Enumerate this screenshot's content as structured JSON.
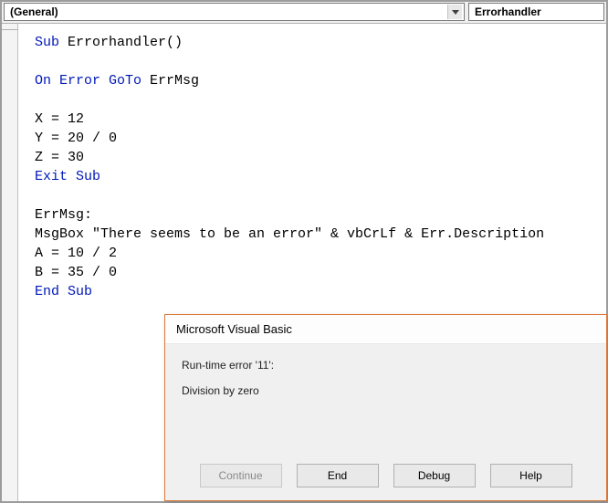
{
  "toolbar": {
    "object_combo": "(General)",
    "procedure_combo": "Errorhandler"
  },
  "code": {
    "sub_decl": {
      "kw1": "Sub",
      "name": " Errorhandler()"
    },
    "on_error": {
      "kw": "On Error GoTo",
      "label": " ErrMsg"
    },
    "l1": "X = 12",
    "l2": "Y = 20 / 0",
    "l3": "Z = 30",
    "exit_sub": "Exit Sub",
    "errmsg_label": "ErrMsg:",
    "msgbox": "MsgBox \"There seems to be an error\" & vbCrLf & Err.Description",
    "l4": "A = 10 / 2",
    "l5": "B = 35 / 0",
    "end_sub": "End Sub"
  },
  "dialog": {
    "title": "Microsoft Visual Basic",
    "error_header": "Run-time error '11':",
    "error_desc": "Division by zero",
    "buttons": {
      "continue": "Continue",
      "end": "End",
      "debug": "Debug",
      "help": "Help"
    }
  }
}
